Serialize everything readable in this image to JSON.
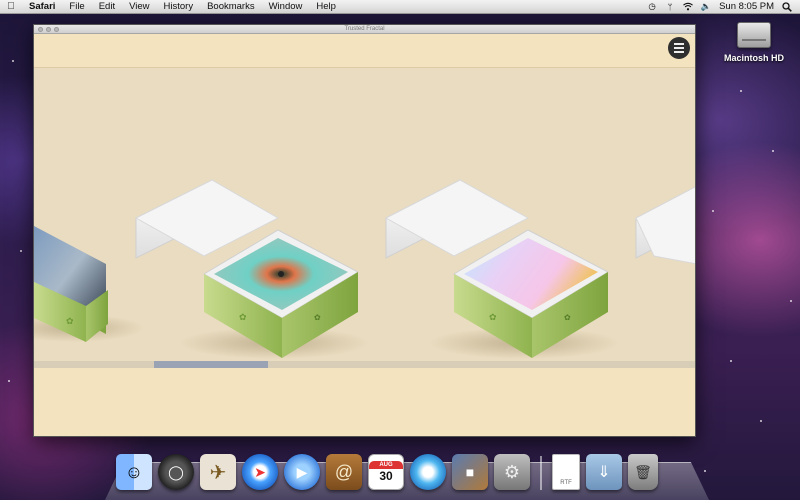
{
  "menubar": {
    "apple_icon": "apple-icon",
    "app_name": "Safari",
    "menus": [
      "File",
      "Edit",
      "View",
      "History",
      "Bookmarks",
      "Window",
      "Help"
    ],
    "clock": "Sun 8:05 PM",
    "status_icons": [
      "time-machine-icon",
      "bluetooth-icon",
      "wifi-icon",
      "volume-icon",
      "spotlight-icon"
    ]
  },
  "desktop": {
    "drive_label": "Macintosh HD"
  },
  "window": {
    "title": "Trusted Fractal",
    "menu_button_icon": "hamburger-icon",
    "scroll_position_fraction": 0.18,
    "background_color": "#eadcc0",
    "bar_color": "#f4e3bf"
  },
  "gallery": {
    "items": [
      {
        "name": "fractal-box-1",
        "palette": [
          "#7d9bbf",
          "#2e3a4a"
        ]
      },
      {
        "name": "fractal-box-2",
        "palette": [
          "#6fd0c5",
          "#b89be8"
        ]
      },
      {
        "name": "fractal-box-3",
        "palette": [
          "#e9d0f5",
          "#f0c36a"
        ]
      },
      {
        "name": "fractal-box-4",
        "palette": []
      }
    ],
    "box_accent_color": "#9fc062"
  },
  "dock": {
    "calendar_month": "AUG",
    "calendar_day": "30",
    "document_label": "RTF",
    "apps": [
      "finder-icon",
      "dashboard-icon",
      "mail-icon",
      "safari-icon",
      "ichat-icon",
      "address-book-icon",
      "ical-icon",
      "itunes-icon",
      "iphoto-icon",
      "system-preferences-icon",
      "rtf-document-icon",
      "downloads-folder-icon",
      "trash-icon"
    ]
  }
}
